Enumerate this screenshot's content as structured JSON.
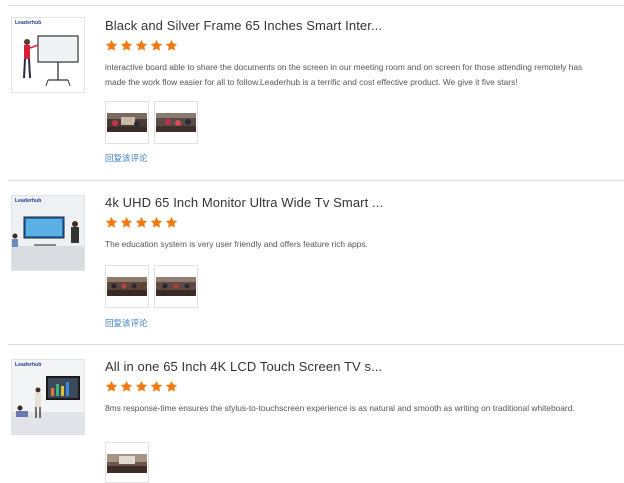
{
  "reviews": [
    {
      "product_logo": "Leaderhub",
      "title": "Black and Silver Frame 65 Inches Smart Inter...",
      "rating": 5,
      "comment": "interactive board able to share the documents on the screen in our meeting room and on screen for those attending remotely has made the work flow easier for all to follow.Leaderhub is a terrific and cost effective product. We give it five stars!",
      "reply_label": "回复该评论"
    },
    {
      "product_logo": "Leaderhub",
      "title": "4k UHD 65 Inch Monitor Ultra Wide Tv Smart ...",
      "rating": 5,
      "comment": "The education system is very user friendly and offers feature rich apps.",
      "reply_label": "回复该评论"
    },
    {
      "product_logo": "Leaderhub",
      "title": "All in one 65 Inch 4K LCD Touch Screen TV s...",
      "rating": 5,
      "comment": "8ms response-time ensures the stylus-to-touchscreen experience is as natural and smooth as writing on traditional whiteboard."
    }
  ],
  "colors": {
    "star": "#f07a14",
    "link": "#3b7fc4",
    "divider": "#dcdcdc"
  }
}
